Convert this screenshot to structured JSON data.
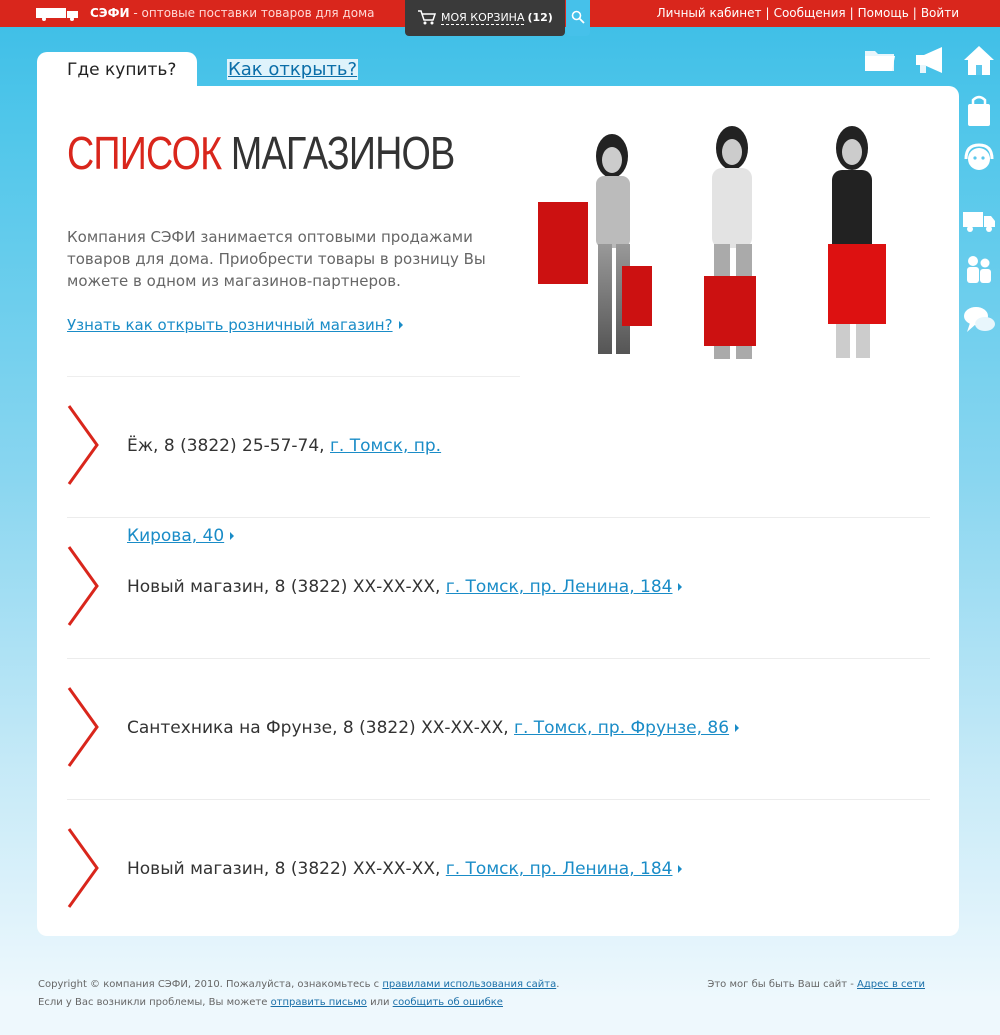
{
  "topbar": {
    "brand": "СЭФИ",
    "tagline": " - оптовые поставки товаров для дома",
    "cart_label": "МОЯ КОРЗИНА",
    "cart_count": "(12)",
    "nav": [
      "Личный кабинет",
      "Сообщения",
      "Помощь",
      "Войти"
    ],
    "separator": "|"
  },
  "tabs": {
    "active": "Где купить?",
    "inactive": "Как открыть?"
  },
  "main": {
    "title_red": "СПИСОК",
    "title_dark": "МАГАЗИНОВ",
    "intro": "Компания СЭФИ занимается оптовыми продажами товаров для дома. Приобрести товары в розницу Вы можете в одном из магазинов-партнеров.",
    "open_link": "Узнать как открыть розничный магазин?"
  },
  "stores": [
    {
      "text": "Ёж, 8 (3822) 25-57-74, ",
      "link": "г. Томск, пр."
    },
    {
      "text": "Новый магазин, 8 (3822) ХХ-ХХ-ХХ, ",
      "link": "г. Томск, пр. Ленина, 184"
    },
    {
      "text": "Сантехника на Фрунзе, 8 (3822) ХХ-ХХ-ХХ, ",
      "link": "г. Томск, пр. Фрунзе, 86"
    },
    {
      "text": "Новый магазин, 8 (3822) ХХ-ХХ-ХХ, ",
      "link": "г. Томск, пр. Ленина, 184"
    }
  ],
  "kirova_link": "Кирова, 40",
  "footer": {
    "p1": "Copyright © компания СЭФИ, 2010. Пожалуйста, ознакомьтесь с ",
    "l1": "правилами использования сайта",
    "p2": ". Если у Вас возникли проблемы, Вы можете ",
    "l2": "отправить письмо",
    "p3": " или ",
    "l3": "сообщить об ошибке",
    "right_text": "Это мог бы быть Ваш сайт - ",
    "right_link": "Адрес в сети"
  },
  "icons": [
    "truck-icon",
    "cart-icon",
    "search-icon",
    "folder-icon",
    "megaphone-icon",
    "home-icon",
    "bag-icon",
    "support-icon",
    "delivery-truck-icon",
    "people-icon",
    "chat-icon"
  ],
  "colors": {
    "accent_red": "#d9261c",
    "link_blue": "#1a8cc7",
    "sky_blue": "#3cbde6"
  }
}
